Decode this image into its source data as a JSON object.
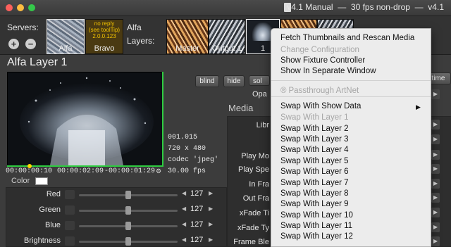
{
  "window": {
    "title": "v4.1 Manual  —  30 fps non-drop  —  v4.1"
  },
  "servers": {
    "label": "Servers:",
    "add_label": "+",
    "remove_label": "−",
    "items": [
      {
        "label": "Alfa"
      },
      {
        "label": "Bravo",
        "status": "no reply\n(see toolTip)\n2.0.0.123"
      }
    ],
    "selected_name": "Alfa"
  },
  "layers": {
    "label": "Layers:",
    "items": [
      {
        "label": "Master"
      },
      {
        "label": "Output 1"
      },
      {
        "label": "1"
      }
    ]
  },
  "layer_title": "Alfa Layer 1",
  "clip": {
    "frame": "001.015",
    "resolution": "720 x 480",
    "codec": "codec 'jpeg'",
    "fps": "30.00 fps",
    "timecode_current": "00:00:00:10",
    "timecode_duration": "00:00:02:09",
    "timecode_remaining": "-00:00:01:29",
    "progress": 0.14
  },
  "buttons": {
    "blind": "blind",
    "hide": "hide",
    "solo_partial": "sol",
    "time": "time"
  },
  "labels": {
    "color": "Color",
    "media": "Media",
    "opacity_partial": "Opa"
  },
  "color_rows": [
    {
      "label": "Red",
      "value": "127",
      "level": 0.5
    },
    {
      "label": "Green",
      "value": "127",
      "level": 0.5
    },
    {
      "label": "Blue",
      "value": "127",
      "level": 0.5
    },
    {
      "label": "Brightness",
      "value": "127",
      "level": 0.5
    }
  ],
  "media_rows": [
    {
      "label": "Libr"
    },
    {
      "label": "Play Mo"
    },
    {
      "label": "Play Spe"
    },
    {
      "label": "In Fra"
    },
    {
      "label": "Out Fra"
    },
    {
      "label": "xFade Ti"
    },
    {
      "label": "xFade Ty"
    },
    {
      "label": "Frame Ble"
    }
  ],
  "context_menu": {
    "items": [
      {
        "label": "Fetch Thumbnails and Rescan Media",
        "enabled": true
      },
      {
        "label": "Change Configuration",
        "enabled": false
      },
      {
        "label": "Show Fixture Controller",
        "enabled": true
      },
      {
        "label": "Show In Separate Window",
        "enabled": true
      },
      {
        "label": "Passthrough ArtNet",
        "enabled": false,
        "icon": "registered-icon",
        "icon_glyph": "®"
      },
      {
        "label": "Swap With Show Data",
        "enabled": true,
        "submenu": true,
        "arrow": "▶"
      },
      {
        "label": "Swap With Layer 1",
        "enabled": false
      },
      {
        "label": "Swap With Layer 2",
        "enabled": true
      },
      {
        "label": "Swap With Layer 3",
        "enabled": true
      },
      {
        "label": "Swap With Layer 4",
        "enabled": true
      },
      {
        "label": "Swap With Layer 5",
        "enabled": true
      },
      {
        "label": "Swap With Layer 6",
        "enabled": true
      },
      {
        "label": "Swap With Layer 7",
        "enabled": true
      },
      {
        "label": "Swap With Layer 8",
        "enabled": true
      },
      {
        "label": "Swap With Layer 9",
        "enabled": true
      },
      {
        "label": "Swap With Layer 10",
        "enabled": true
      },
      {
        "label": "Swap With Layer 11",
        "enabled": true
      },
      {
        "label": "Swap With Layer 12",
        "enabled": true
      }
    ]
  },
  "colors": {
    "titlebar_close": "#fc605c",
    "titlebar_minimize": "#fdbc40",
    "titlebar_zoom": "#34c84a",
    "bravo_status": "#e8b400",
    "selected_thumb_border": "#ffffff",
    "progress_green": "#2ecc40"
  }
}
